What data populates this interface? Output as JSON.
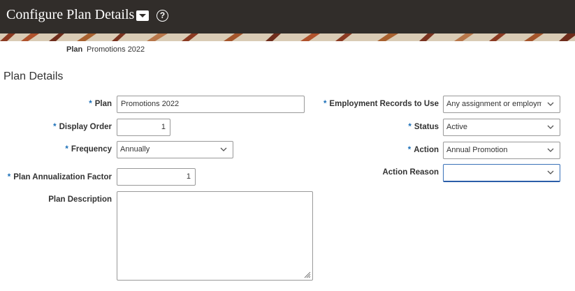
{
  "header": {
    "title": "Configure Plan Details",
    "title_menu_icon": "menu-dropdown-icon",
    "help_icon": "help-icon",
    "help_glyph": "?"
  },
  "breadcrumb": {
    "label": "Plan",
    "value": "Promotions 2022"
  },
  "section": {
    "title": "Plan Details"
  },
  "form": {
    "required_marker": "*",
    "plan": {
      "label": "Plan",
      "value": "Promotions 2022"
    },
    "display_order": {
      "label": "Display Order",
      "value": "1"
    },
    "frequency": {
      "label": "Frequency",
      "value": "Annually"
    },
    "annualization": {
      "label": "Plan Annualization Factor",
      "value": "1"
    },
    "description": {
      "label": "Plan Description",
      "value": ""
    },
    "employment_records": {
      "label": "Employment Records to Use",
      "value": "Any assignment or employme"
    },
    "status": {
      "label": "Status",
      "value": "Active"
    },
    "action": {
      "label": "Action",
      "value": "Annual Promotion"
    },
    "action_reason": {
      "label": "Action Reason",
      "value": ""
    }
  },
  "colors": {
    "header_bg": "#312d2a",
    "required": "#1a6fb8",
    "focus": "#2b5ea8"
  }
}
